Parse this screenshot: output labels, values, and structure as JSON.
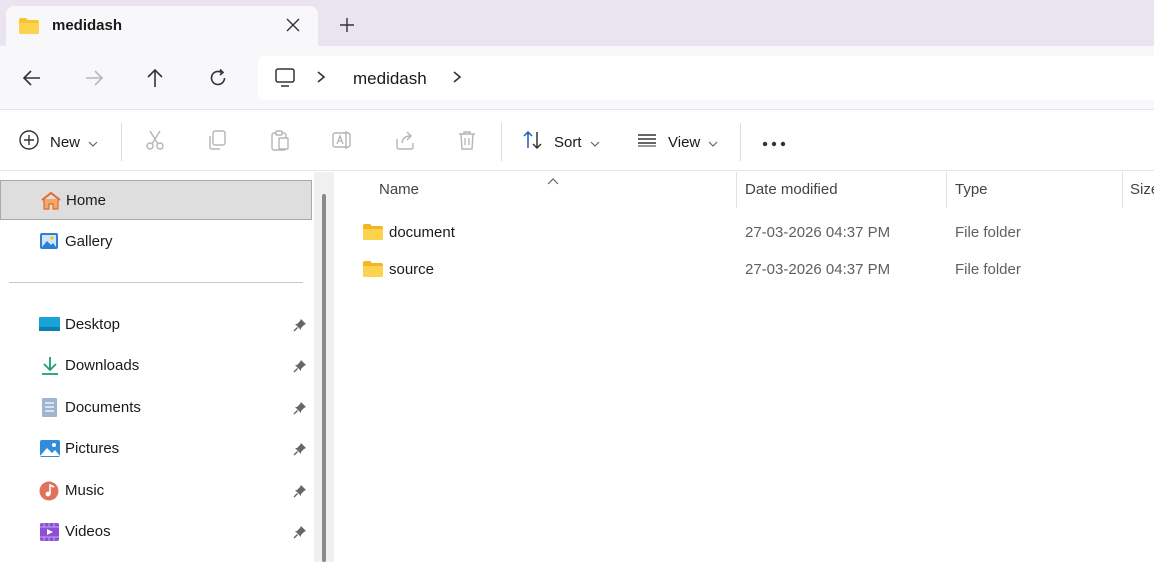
{
  "tab": {
    "title": "medidash"
  },
  "address": {
    "segments": [
      "medidash"
    ]
  },
  "commands": {
    "new_label": "New",
    "sort_label": "Sort",
    "view_label": "View"
  },
  "sidebar": {
    "top_items": [
      {
        "label": "Home",
        "icon": "home-icon",
        "selected": true
      },
      {
        "label": "Gallery",
        "icon": "gallery-icon"
      }
    ],
    "quick_access": [
      {
        "label": "Desktop",
        "icon": "desktop-icon",
        "pinned": true
      },
      {
        "label": "Downloads",
        "icon": "downloads-icon",
        "pinned": true
      },
      {
        "label": "Documents",
        "icon": "documents-icon",
        "pinned": true
      },
      {
        "label": "Pictures",
        "icon": "pictures-icon",
        "pinned": true
      },
      {
        "label": "Music",
        "icon": "music-icon",
        "pinned": true
      },
      {
        "label": "Videos",
        "icon": "videos-icon",
        "pinned": true
      }
    ]
  },
  "columns": [
    "Name",
    "Date modified",
    "Type",
    "Size"
  ],
  "files": [
    {
      "name": "document",
      "date": "27-03-2026 04:37 PM",
      "type": "File folder"
    },
    {
      "name": "source",
      "date": "27-03-2026 04:37 PM",
      "type": "File folder"
    }
  ],
  "colors": {
    "tabbar_bg": "#e9e4f0",
    "folder_yellow": "#f8c42d",
    "selected_bg": "#dedede"
  }
}
